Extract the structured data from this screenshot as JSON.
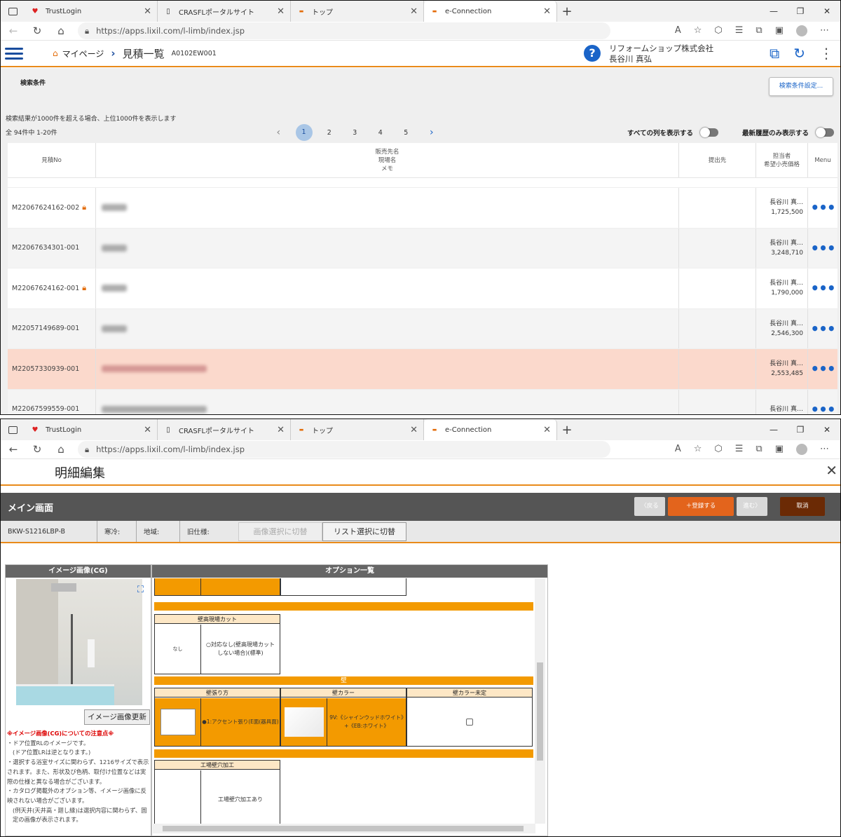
{
  "browser": {
    "tabs": [
      {
        "title": "TrustLogin",
        "icon": "trustlogin-icon"
      },
      {
        "title": "CRASFLポータルサイト",
        "icon": "page-icon"
      },
      {
        "title": "トップ",
        "icon": "lixil-icon"
      },
      {
        "title": "e-Connection",
        "icon": "lixil-icon"
      }
    ],
    "url": "https://apps.lixil.com/l-limb/index.jsp"
  },
  "app1": {
    "breadcrumb_home": "マイページ",
    "page_title": "見積一覧",
    "page_code": "A0102EW001",
    "company": "リフォームショップ株式会社",
    "user": "長谷川 真弘",
    "search_label": "検索条件",
    "search_settings_button": "検索条件設定...",
    "result_note": "検索結果が1000件を超える場合、上位1000件を表示します",
    "count_text": "全 94件中 1-20件",
    "pages": [
      "1",
      "2",
      "3",
      "4",
      "5"
    ],
    "current_page": "1",
    "toggle_all_columns": "すべての列を表示する",
    "toggle_latest_only": "最新履歴のみ表示する",
    "columns": {
      "no": "見積No",
      "customer_line1": "販売先名",
      "customer_line2": "現場名",
      "customer_line3": "メモ",
      "submit": "提出先",
      "staff_line1": "担当者",
      "staff_line2": "希望小売価格",
      "menu": "Menu"
    },
    "rows": [
      {
        "no": "M22067624162-002",
        "locked": true,
        "staff": "長谷川 真…",
        "price": "1,725,500"
      },
      {
        "no": "M22067634301-001",
        "locked": false,
        "staff": "長谷川 真…",
        "price": "3,248,710"
      },
      {
        "no": "M22067624162-001",
        "locked": true,
        "staff": "長谷川 真…",
        "price": "1,790,000"
      },
      {
        "no": "M22057149689-001",
        "locked": false,
        "staff": "長谷川 真…",
        "price": "2,546,300"
      },
      {
        "no": "M22057330939-001",
        "locked": false,
        "staff": "長谷川 真…",
        "price": "2,553,485"
      },
      {
        "no": "M22067599559-001",
        "locked": false,
        "staff": "長谷川 真…",
        "price": ""
      }
    ],
    "menu_glyph": "•••"
  },
  "app2": {
    "title": "明細編集",
    "main_label": "メイン画面",
    "btn_back": "〈戻る",
    "btn_register": "＋登録する",
    "btn_next": "進む〉",
    "btn_cancel": "取消",
    "product_code": "BKW-S1216LBP-B",
    "field_cold": "寒冷:",
    "field_region": "地域:",
    "field_old_spec": "旧仕様:",
    "btn_image_select": "画像選択に切替",
    "btn_list_select": "リスト選択に切替",
    "image_panel_title": "イメージ画像(CG)",
    "image_update_button": "イメージ画像更新",
    "notes_title": "※イメージ画像(CG)についての注意点※",
    "notes": [
      "・ドア位置RLのイメージです。",
      "(ドア位置LRは逆となります。)",
      "・選択する浴室サイズに関わらず、1216サイズで表示されます。また、形状及び色柄、取付け位置などは実際の仕様と異なる場合がございます。",
      "・カタログ掲載外のオプション等、イメージ画像に反映されない場合がございます。",
      "(例天井(天井高・廻し縁)は選択内容に関わらず、固定の画像が表示されます。"
    ],
    "options_title": "オプション一覧",
    "options": {
      "wall_height_cut": "壁高現場カット",
      "none": "なし",
      "wall_height_std": "○対応なし(壁高現場カットしない場合)(標準)",
      "wall_section": "壁",
      "wall_method": "壁張り方",
      "wall_method_sel": "●1:アクセント張り(E面(器具面)",
      "wall_color": "壁カラー",
      "wall_color_sel": "9V:《シャインウッドホワイト》+《EB:ホワイト》",
      "wall_color_undecided": "壁カラー未定",
      "factory_hole": "工場壁穴加工",
      "factory_hole_val": "工場壁穴加工あり"
    }
  }
}
